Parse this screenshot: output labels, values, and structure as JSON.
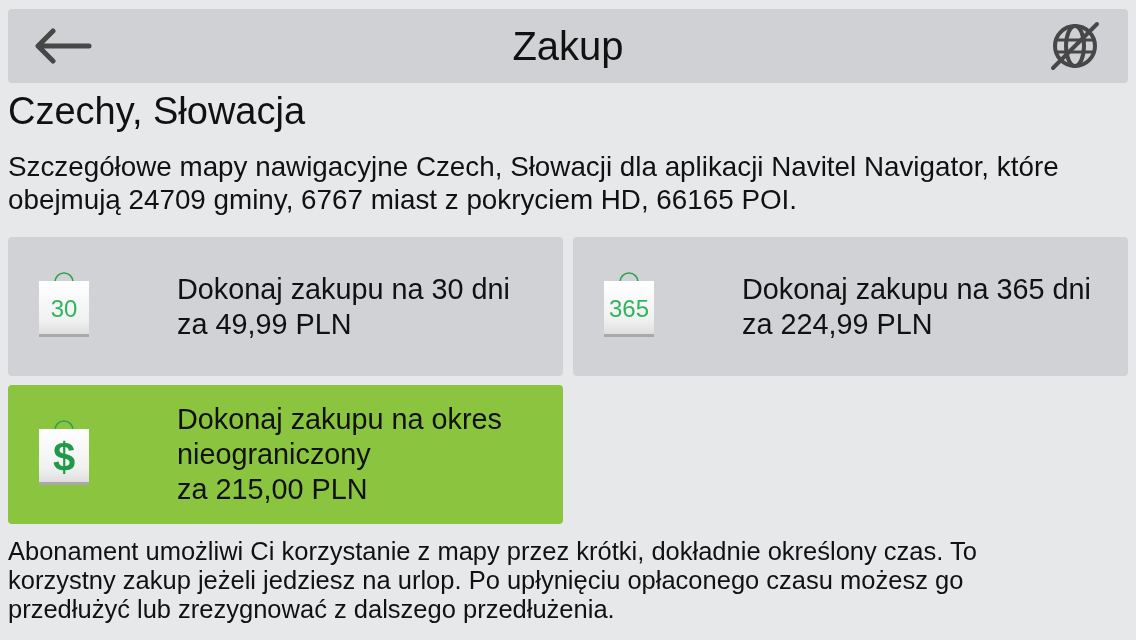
{
  "header": {
    "title": "Zakup"
  },
  "region": {
    "title": "Czechy, Słowacja",
    "description": "Szczegółowe mapy nawigacyjne Czech, Słowacji dla aplikacji Navitel Navigator, które obejmują 24709 gminy, 6767 miast z pokryciem HD, 66165 POI."
  },
  "options": [
    {
      "kind": "days",
      "badge": "30",
      "title": "Dokonaj zakupu na 30 dni",
      "price": "za 49,99 PLN",
      "selected": false
    },
    {
      "kind": "days",
      "badge": "365",
      "title": "Dokonaj zakupu na 365 dni",
      "price": "za 224,99 PLN",
      "selected": false
    },
    {
      "kind": "unlimited",
      "badge": "$",
      "title": "Dokonaj zakupu na okres nieograniczony",
      "price": "za 215,00 PLN",
      "selected": true
    }
  ],
  "note": "Abonament umożliwi Ci korzystanie z mapy przez krótki, dokładnie określony czas. To korzystny zakup jeżeli jedziesz na urlop. Po upłynięciu opłaconego czasu możesz go przedłużyć lub zrezygnować z dalszego przedłużenia."
}
